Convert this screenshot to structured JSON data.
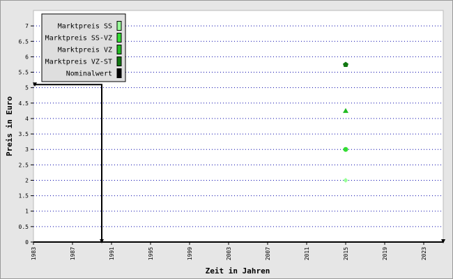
{
  "chart_data": {
    "type": "scatter",
    "xlabel": "Zeit in Jahren",
    "ylabel": "Preis in Euro",
    "xlim": [
      1983,
      2025
    ],
    "ylim": [
      0,
      7.5
    ],
    "x_ticks": [
      "1983",
      "1987",
      "1991",
      "1995",
      "1999",
      "2003",
      "2007",
      "2011",
      "2015",
      "2019",
      "2023"
    ],
    "y_ticks": [
      "0",
      "0.5",
      "1",
      "1.5",
      "2",
      "2.5",
      "3",
      "3.5",
      "4",
      "4.5",
      "5",
      "5.5",
      "6",
      "6.5",
      "7"
    ],
    "grid": "horizontal-dotted",
    "legend_position": "top-left",
    "series": [
      {
        "name": "Marktpreis SS",
        "color": "#99ff99",
        "marker": "diamond",
        "points": [
          {
            "x": 2015,
            "y": 2.0
          }
        ]
      },
      {
        "name": "Marktpreis SS-VZ",
        "color": "#33dd33",
        "marker": "circle",
        "points": [
          {
            "x": 2015,
            "y": 3.0
          }
        ]
      },
      {
        "name": "Marktpreis VZ",
        "color": "#22bb22",
        "marker": "triangle",
        "points": [
          {
            "x": 2015,
            "y": 4.25
          }
        ]
      },
      {
        "name": "Marktpreis VZ-ST",
        "color": "#117711",
        "marker": "pentagon",
        "points": [
          {
            "x": 2015,
            "y": 5.75
          }
        ]
      },
      {
        "name": "Nominalwert",
        "color": "#000000",
        "marker": "line",
        "points": [
          {
            "x": 1990,
            "y": 5.1
          }
        ]
      }
    ],
    "reference_lines": [
      {
        "series": "Nominalwert",
        "from": {
          "x": 1983,
          "y": 5.1
        },
        "corner": {
          "x": 1990,
          "y": 5.1
        },
        "to": {
          "x": 1990,
          "y": 0
        }
      }
    ]
  }
}
